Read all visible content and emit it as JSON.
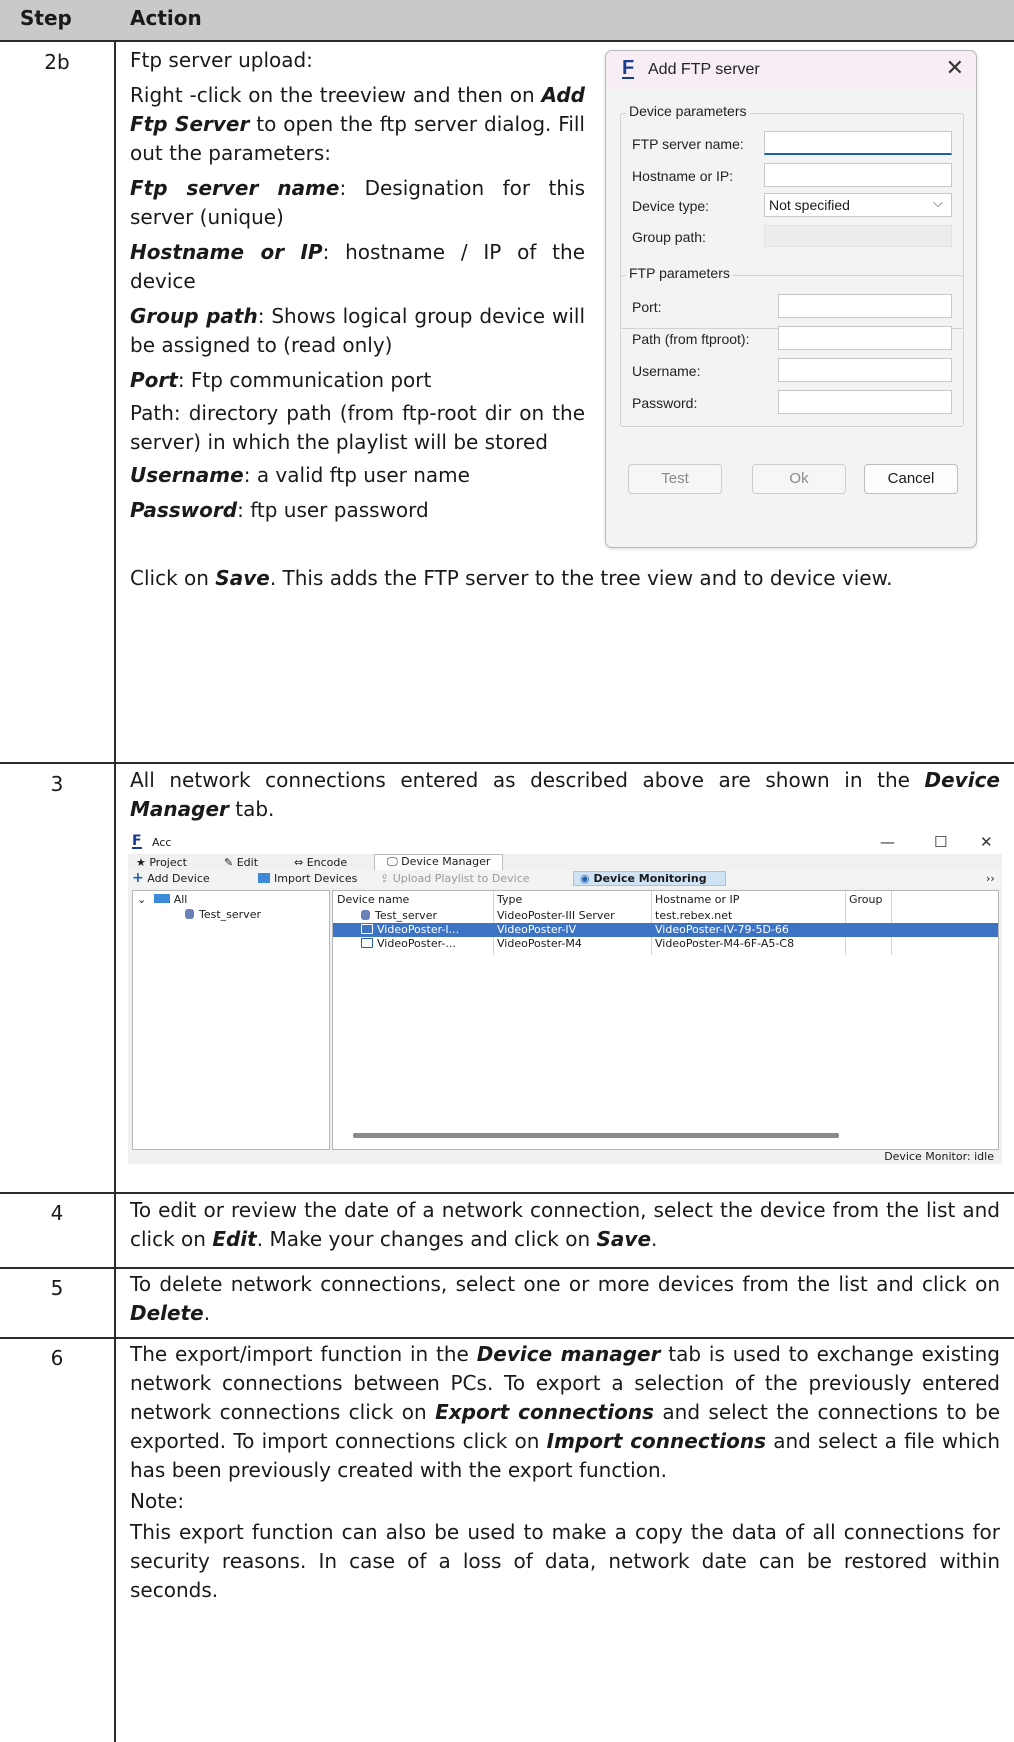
{
  "table": {
    "header_step": "Step",
    "header_action": "Action"
  },
  "row_2b": {
    "step": "2b",
    "title": "Ftp server upload:",
    "p1_a": "Right -click on the treeview and then on",
    "p1_b_bold": "Add Ftp Server",
    "p1_c": "to open the ftp server dialog. Fill out the parameters:",
    "ftp_name_bold": "Ftp server name",
    "ftp_name_text": ": Designation for this server (unique)",
    "host_bold": "Hostname or IP",
    "host_text": ": hostname / IP of the device",
    "group_bold": "Group path",
    "group_text": ": Shows logical group device will be assigned to (read only)",
    "port_bold": "Port",
    "port_text": ": Ftp communication port",
    "path_text": "Path: directory path (from ftp-root dir on the server) in which the playlist will be stored",
    "user_bold": "Username",
    "user_text": ": a valid ftp user name",
    "pass_bold": "Password",
    "pass_text": ": ftp user password",
    "save_a": "Click on",
    "save_bold": "Save",
    "save_c": ". This adds the FTP server to the tree view and to device view."
  },
  "dialog": {
    "logo": "F",
    "title": "Add FTP server",
    "close": "✕",
    "device_group": "Device parameters",
    "ftp_name_label": "FTP server name:",
    "hostname_label": "Hostname or IP:",
    "device_type_label": "Device type:",
    "device_type_value": "Not specified",
    "group_path_label": "Group path:",
    "ftp_group": "FTP parameters",
    "port_label": "Port:",
    "path_label": "Path (from ftproot):",
    "username_label": "Username:",
    "password_label": "Password:",
    "test_button": "Test",
    "ok_button": "Ok",
    "cancel_button": "Cancel"
  },
  "row_3": {
    "step": "3",
    "text_a": "All network connections entered as described above are shown in the",
    "bold": "Device Manager",
    "text_c": "tab."
  },
  "app": {
    "logo": "F",
    "title": "Acc",
    "minimize": "—",
    "maximize": "☐",
    "close": "✕",
    "tabs": [
      "★ Project",
      "✎ Edit",
      "⇔ Encode",
      "🖵 Device Manager"
    ],
    "toolbar": {
      "add_device": "Add Device",
      "import_devices": "Import Devices",
      "upload_playlist": "Upload Playlist to Device",
      "device_monitoring": "Device Monitoring",
      "more": "››"
    },
    "tree": {
      "root": "All",
      "child": "Test_server"
    },
    "columns": [
      "Device name",
      "Type",
      "Hostname or IP",
      "Group"
    ],
    "rows": [
      {
        "name": "Test_server",
        "type": "VideoPoster-III Server",
        "host": "test.rebex.net"
      },
      {
        "name": "VideoPoster-I...",
        "type": "VideoPoster-IV",
        "host": "VideoPoster-IV-79-5D-66"
      },
      {
        "name": "VideoPoster-...",
        "type": "VideoPoster-M4",
        "host": "VideoPoster-M4-6F-A5-C8"
      }
    ],
    "status": "Device Monitor: idle"
  },
  "row_4": {
    "step": "4",
    "text_a": "To edit or review the date of a network connection, select the device from the list and click on",
    "bold_edit": "Edit",
    "text_b": ". Make your changes and click on",
    "bold_save": "Save",
    "text_c": "."
  },
  "row_5": {
    "step": "5",
    "text_a": "To delete network connections, select one or more devices from the list and click on",
    "bold": "Delete",
    "text_b": "."
  },
  "row_6": {
    "step": "6",
    "t1": "The export/import function in the",
    "b1": "Device manager",
    "t2": "tab is used to exchange existing network connections between PCs. To export a selection of the previously entered network connections click on",
    "b2": "Export connections",
    "t3": "and select the connections to be exported. To import connections click on",
    "b3": "Import connections",
    "t4": "and select a file which has been previously created with the export function.",
    "note_label": "Note:",
    "note_text": "This export function can also be used to make a copy the data of all connections for security reasons. In case of a loss of data, network date can be restored within seconds."
  }
}
